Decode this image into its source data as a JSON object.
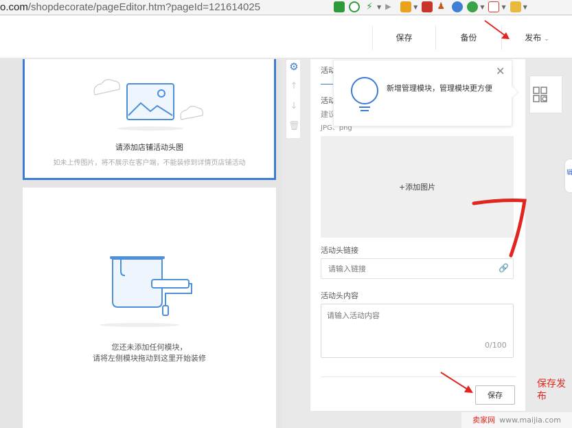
{
  "browser": {
    "url_domain": "o.com",
    "url_path": "/shopdecorate/pageEditor.htm?pageId=121614025"
  },
  "toolbar": {
    "save_label": "保存",
    "backup_label": "备份",
    "publish_label": "发布"
  },
  "canvas": {
    "image_module_hint": "请添加店铺活动头图",
    "image_module_sub": "如未上传图片，将不展示在客户端，不能装修到详情页店铺活动",
    "empty_line1": "您还未添加任何模块，",
    "empty_line2": "请将左侧模块拖动到这里开始装修"
  },
  "panel": {
    "label_top1": "活动",
    "label_top2": "活动",
    "label_top3": "建议",
    "label_top4": "JPG、png",
    "upload_label": "+添加图片",
    "link_label": "活动头链接",
    "link_placeholder": "请输入链接",
    "content_label": "活动头内容",
    "content_placeholder": "请输入活动内容",
    "content_counter": "0/100",
    "save_label": "保存"
  },
  "popover": {
    "text": "新增管理模块，管理模块更方便",
    "close_glyph": "✕"
  },
  "edge_tab": "辑",
  "annotation": {
    "note": "保存发布"
  },
  "watermark": {
    "left": "卖家网",
    "right": "www.maijia.com"
  },
  "colors": {
    "accent": "#3a7bd5",
    "annotation_red": "#e0261f",
    "illustration_blue": "#4d8fd8"
  }
}
